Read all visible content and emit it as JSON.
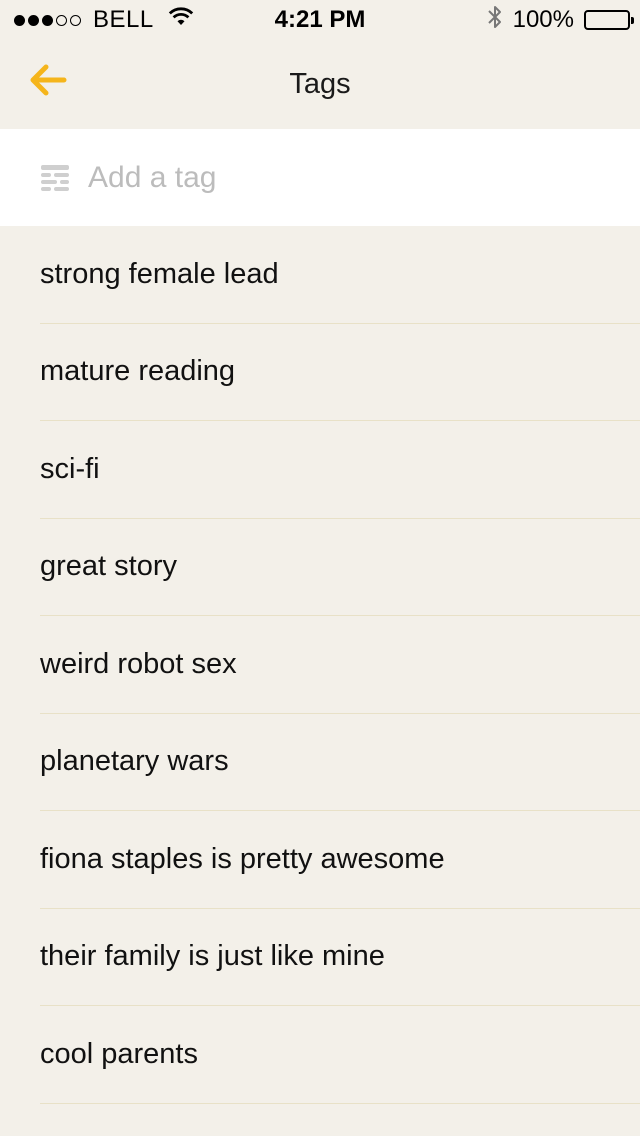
{
  "status_bar": {
    "carrier": "BELL",
    "time": "4:21 PM",
    "battery_percent": "100%",
    "signal_strength": 3,
    "signal_max": 5
  },
  "nav": {
    "title": "Tags",
    "back_icon": "arrow-left-icon",
    "accent_color": "#f5b51b"
  },
  "add_tag": {
    "placeholder": "Add a tag",
    "value": "",
    "icon": "tag-field-icon"
  },
  "tags": [
    {
      "label": "strong female lead"
    },
    {
      "label": "mature reading"
    },
    {
      "label": "sci-fi"
    },
    {
      "label": "great story"
    },
    {
      "label": "weird robot sex"
    },
    {
      "label": "planetary wars"
    },
    {
      "label": "fiona staples is pretty awesome"
    },
    {
      "label": "their family is just like mine"
    },
    {
      "label": "cool parents"
    }
  ]
}
